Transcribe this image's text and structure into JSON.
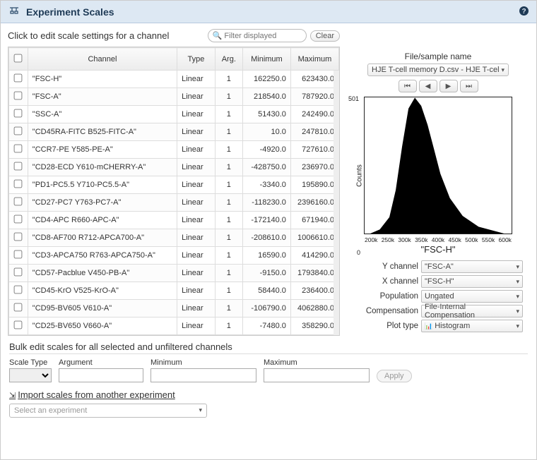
{
  "header": {
    "title": "Experiment Scales"
  },
  "subheader": "Click to edit scale settings for a channel",
  "filter": {
    "placeholder": "Filter displayed",
    "clear": "Clear"
  },
  "columns": {
    "channel": "Channel",
    "type": "Type",
    "arg": "Arg.",
    "min": "Minimum",
    "max": "Maximum"
  },
  "rows": [
    {
      "name": "\"FSC-H\"",
      "type": "Linear",
      "arg": "1",
      "min": "162250.0",
      "max": "623430.0"
    },
    {
      "name": "\"FSC-A\"",
      "type": "Linear",
      "arg": "1",
      "min": "218540.0",
      "max": "787920.0"
    },
    {
      "name": "\"SSC-A\"",
      "type": "Linear",
      "arg": "1",
      "min": "51430.0",
      "max": "242490.0"
    },
    {
      "name": "\"CD45RA-FITC B525-FITC-A\"",
      "type": "Linear",
      "arg": "1",
      "min": "10.0",
      "max": "247810.0"
    },
    {
      "name": "\"CCR7-PE Y585-PE-A\"",
      "type": "Linear",
      "arg": "1",
      "min": "-4920.0",
      "max": "727610.0"
    },
    {
      "name": "\"CD28-ECD Y610-mCHERRY-A\"",
      "type": "Linear",
      "arg": "1",
      "min": "-428750.0",
      "max": "236970.0"
    },
    {
      "name": "\"PD1-PC5.5 Y710-PC5.5-A\"",
      "type": "Linear",
      "arg": "1",
      "min": "-3340.0",
      "max": "195890.0"
    },
    {
      "name": "\"CD27-PC7 Y763-PC7-A\"",
      "type": "Linear",
      "arg": "1",
      "min": "-118230.0",
      "max": "2396160.0"
    },
    {
      "name": "\"CD4-APC R660-APC-A\"",
      "type": "Linear",
      "arg": "1",
      "min": "-172140.0",
      "max": "671940.0"
    },
    {
      "name": "\"CD8-AF700 R712-APCA700-A\"",
      "type": "Linear",
      "arg": "1",
      "min": "-208610.0",
      "max": "1006610.0"
    },
    {
      "name": "\"CD3-APCA750 R763-APCA750-A\"",
      "type": "Linear",
      "arg": "1",
      "min": "16590.0",
      "max": "414290.0"
    },
    {
      "name": "\"CD57-Pacblue V450-PB-A\"",
      "type": "Linear",
      "arg": "1",
      "min": "-9150.0",
      "max": "1793840.0"
    },
    {
      "name": "\"CD45-KrO V525-KrO-A\"",
      "type": "Linear",
      "arg": "1",
      "min": "58440.0",
      "max": "236400.0"
    },
    {
      "name": "\"CD95-BV605 V610-A\"",
      "type": "Linear",
      "arg": "1",
      "min": "-106790.0",
      "max": "4062880.0"
    },
    {
      "name": "\"CD25-BV650 V660-A\"",
      "type": "Linear",
      "arg": "1",
      "min": "-7480.0",
      "max": "358290.0"
    }
  ],
  "bulk": {
    "title": "Bulk edit scales for all selected and unfiltered channels",
    "scale_type": "Scale Type",
    "argument": "Argument",
    "minimum": "Minimum",
    "maximum": "Maximum",
    "apply": "Apply"
  },
  "import": {
    "title": "Import scales from another experiment",
    "placeholder": "Select an experiment"
  },
  "rightPane": {
    "file_label": "File/sample name",
    "sample": "HJE T-cell memory D.csv - HJE T-cel",
    "y_axis_label": "Counts",
    "y_max": "501",
    "y_min": "0",
    "x_ticks": [
      "200k",
      "250k",
      "300k",
      "350k",
      "400k",
      "450k",
      "500k",
      "550k",
      "600k"
    ],
    "x_label": "\"FSC-H\"",
    "controls": {
      "y_channel_l": "Y channel",
      "y_channel_v": "\"FSC-A\"",
      "x_channel_l": "X channel",
      "x_channel_v": "\"FSC-H\"",
      "population_l": "Population",
      "population_v": "Ungated",
      "comp_l": "Compensation",
      "comp_v": "File-Internal Compensation",
      "plot_type_l": "Plot type",
      "plot_type_v": "Histogram"
    }
  },
  "chart_data": {
    "type": "area",
    "title": "",
    "xlabel": "\"FSC-H\"",
    "ylabel": "Counts",
    "ylim": [
      0,
      501
    ],
    "xlim": [
      162250,
      623430
    ],
    "x": [
      180000,
      210000,
      240000,
      260000,
      280000,
      300000,
      320000,
      340000,
      360000,
      380000,
      400000,
      430000,
      470000,
      520000,
      600000
    ],
    "y": [
      0,
      15,
      60,
      160,
      320,
      460,
      500,
      470,
      400,
      310,
      220,
      130,
      65,
      25,
      0
    ]
  }
}
